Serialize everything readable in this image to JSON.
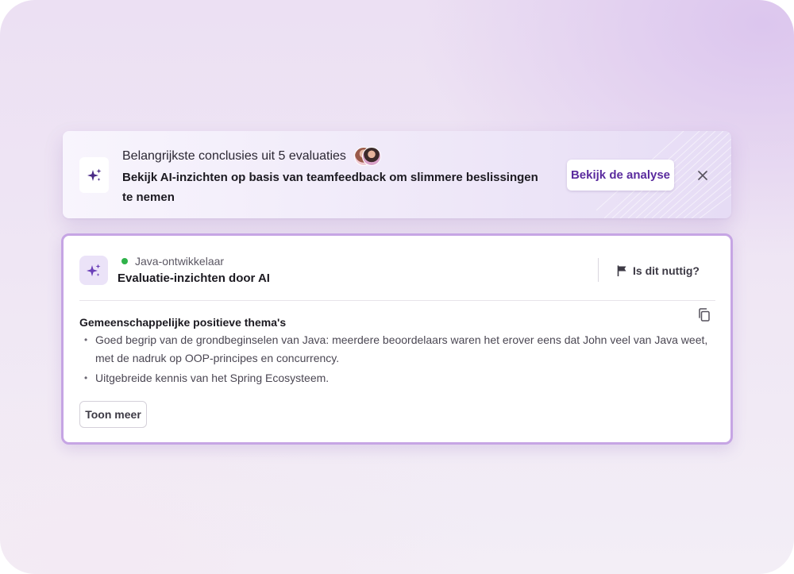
{
  "banner": {
    "icon": "sparkle-icon",
    "subtitle": "Belangrijkste conclusies uit 5 evaluaties",
    "avatars": [
      "reviewer-avatar",
      "reviewer-avatar"
    ],
    "title": "Bekijk AI-inzichten op basis van teamfeedback om slimmere beslissingen te nemen",
    "action_label": "Bekijk de analyse",
    "close_icon": "close-icon"
  },
  "card": {
    "icon": "sparkle-icon",
    "status_color": "#2fb24a",
    "role": "Java-ontwikkelaar",
    "title": "Evaluatie-inzichten door AI",
    "feedback_label": "Is dit nuttig?",
    "feedback_icon": "flag-icon",
    "copy_icon": "copy-icon",
    "section_title": "Gemeenschappelijke positieve thema's",
    "bullets": [
      "Goed begrip van de grondbeginselen van Java: meerdere beoordelaars waren het erover eens dat John veel van Java weet, met de nadruk op OOP-principes en concurrency.",
      "Uitgebreide kennis van het Spring Ecosysteem."
    ],
    "more_label": "Toon meer"
  },
  "colors": {
    "accent": "#5a2b9e",
    "card_border": "#c6a5e4"
  }
}
